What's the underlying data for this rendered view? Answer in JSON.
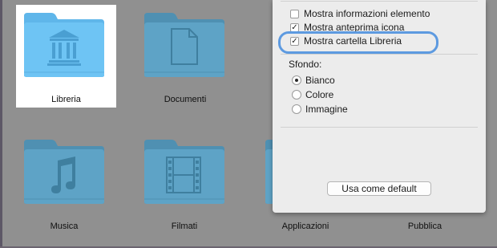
{
  "finder": {
    "items": [
      {
        "label": "Libreria",
        "icon": "library-building-icon",
        "selected": true
      },
      {
        "label": "Documenti",
        "icon": "document-icon"
      },
      {
        "label": "Musica",
        "icon": "music-note-icon"
      },
      {
        "label": "Filmati",
        "icon": "film-strip-icon"
      },
      {
        "label": "Applicazioni",
        "icon": "applications-icon"
      },
      {
        "label": "Pubblica",
        "icon": "public-icon"
      }
    ]
  },
  "view_options": {
    "checkboxes": [
      {
        "label": "Mostra informazioni elemento",
        "checked": false,
        "mark": ""
      },
      {
        "label": "Mostra anteprima icona",
        "checked": true,
        "mark": "✓"
      },
      {
        "label": "Mostra cartella Libreria",
        "checked": true,
        "mark": "✓"
      }
    ],
    "background_label": "Sfondo:",
    "background_options": [
      {
        "label": "Bianco",
        "selected": true
      },
      {
        "label": "Colore",
        "selected": false
      },
      {
        "label": "Immagine",
        "selected": false
      }
    ],
    "default_button": "Usa come default"
  },
  "colors": {
    "folder": "#5ea3c6",
    "folder_selected": "#64bdf0",
    "highlight": "#5d9ae0",
    "panel": "#ececec"
  }
}
